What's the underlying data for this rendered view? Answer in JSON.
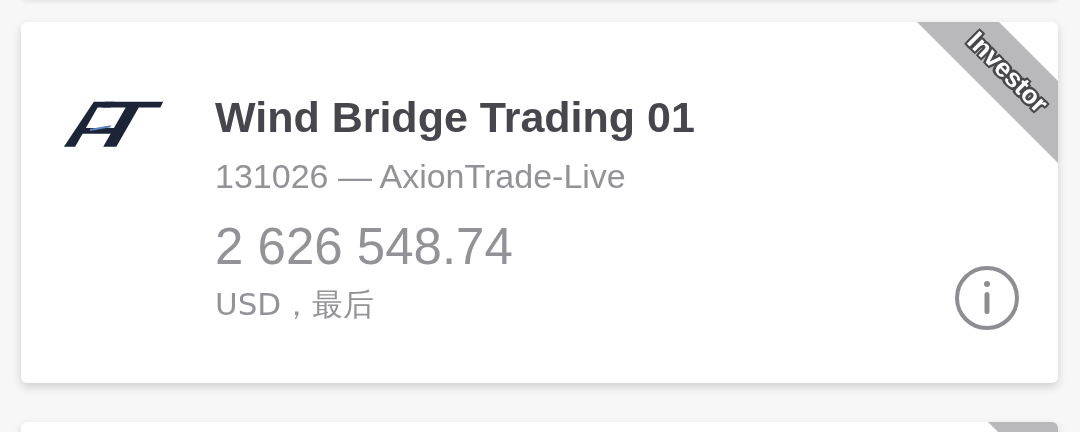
{
  "account": {
    "name": "Wind Bridge Trading 01",
    "subtitle": "131026 — AxionTrade-Live",
    "balance": "2 626 548.74",
    "currency_note": "USD，最后",
    "ribbon": "Investor"
  }
}
